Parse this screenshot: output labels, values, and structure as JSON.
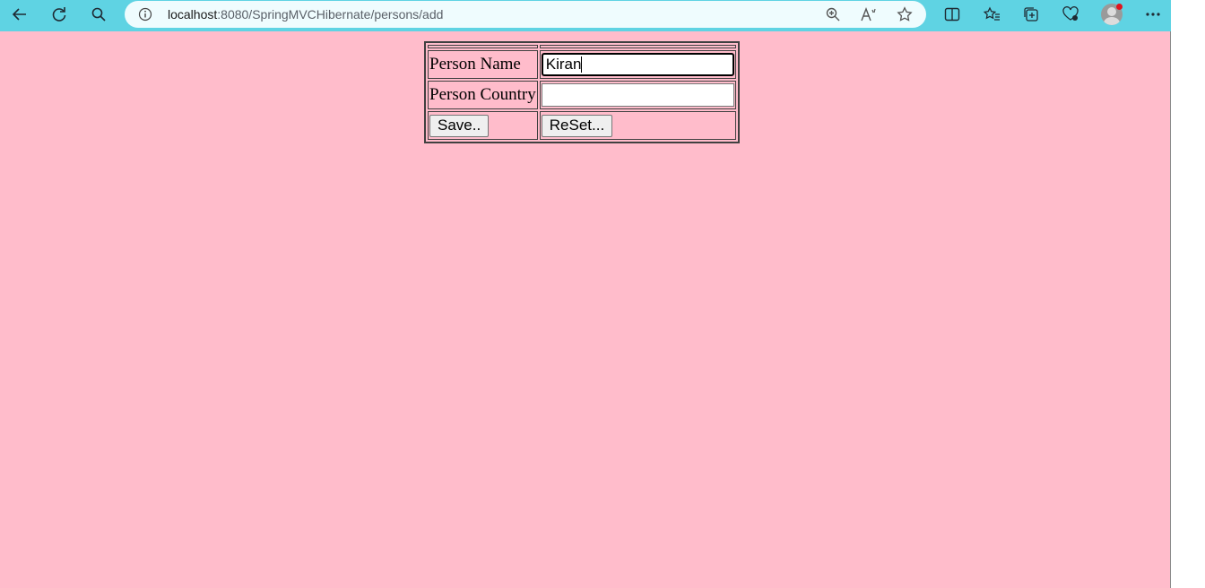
{
  "browser": {
    "url_host": "localhost",
    "url_rest": ":8080/SpringMVCHibernate/persons/add"
  },
  "form": {
    "name_label": "Person Name",
    "name_value": "Kiran",
    "country_label": "Person Country",
    "country_value": "",
    "save_label": "Save..",
    "reset_label": "ReSet..."
  },
  "colors": {
    "page_background": "#ffbccb",
    "toolbar": "#5fd3e3"
  }
}
